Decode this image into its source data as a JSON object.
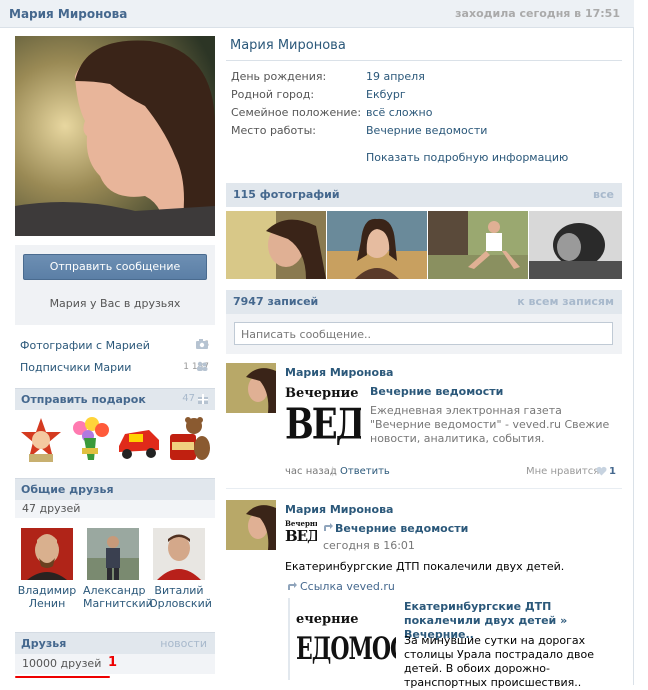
{
  "header": {
    "name": "Мария Миронова",
    "last_seen": "заходила сегодня в 17:51"
  },
  "sidebar": {
    "send_button": "Отправить сообщение",
    "friend_status": "Мария у Вас в друзьях",
    "links": [
      {
        "label": "Фотографии с Марией",
        "count": "6",
        "icon": "camera-icon"
      },
      {
        "label": "Подписчики Марии",
        "count": "1 187",
        "icon": "people-icon"
      }
    ],
    "gifts": {
      "title": "Отправить подарок",
      "count": "47",
      "icon": "gift-icon"
    },
    "mutual": {
      "title": "Общие друзья",
      "subtitle": "47 друзей",
      "friends": [
        {
          "first": "Владимир",
          "last": "Ленин"
        },
        {
          "first": "Александр",
          "last": "Магнитский"
        },
        {
          "first": "Виталий",
          "last": "Орловский"
        }
      ]
    },
    "friends": {
      "title": "Друзья",
      "link": "новости",
      "count": "10000 друзей",
      "annotation": "1"
    }
  },
  "profile": {
    "name": "Мария Миронова",
    "fields": [
      {
        "label": "День рождения:",
        "value": "19 апреля"
      },
      {
        "label": "Родной город:",
        "value": "Екбург"
      },
      {
        "label": "Семейное положение:",
        "value": "всё сложно"
      },
      {
        "label": "Место работы:",
        "value": "Вечерние ведомости"
      }
    ],
    "show_more": "Показать подробную информацию"
  },
  "photos": {
    "title": "115 фотографий",
    "link": "все"
  },
  "wall": {
    "title": "7947 записей",
    "link": "к всем записям",
    "placeholder": "Написать сообщение..",
    "posts": [
      {
        "author": "Мария Миронова",
        "link_title": "Вечерние ведомости",
        "description": "Ежедневная электронная газета \"Вечерние ведомости\" - veved.ru Свежие новости, аналитика, события.",
        "time": "час назад",
        "reply": "Ответить",
        "likes_label": "Мне нравится",
        "likes": "1",
        "logo_top": "Вечерние",
        "logo_bottom": "ВЕДО"
      },
      {
        "author": "Мария Миронова",
        "repost_title": "Вечерние ведомости",
        "repost_time": "сегодня в 16:01",
        "text": "Екатеринбургские ДТП покалечили двух детей.",
        "source": "Ссылка veved.ru",
        "article_title": "Екатеринбургские ДТП покалечили двух детей » Вечерние..",
        "article_text": "За минувшие сутки на дорогах столицы Урала пострадало двое детей. В обоих дорожно-транспортных происшествия..",
        "logo_top": "Вечерние",
        "logo_bottom": "ВЕДО",
        "article_logo_top": "ечерние",
        "article_logo_bottom": "ЕДОМОСТИ"
      }
    ]
  },
  "colors": {
    "link": "#2b587a",
    "header": "#45688e",
    "button": "#5b7fa6",
    "annotation": "#e00000"
  }
}
